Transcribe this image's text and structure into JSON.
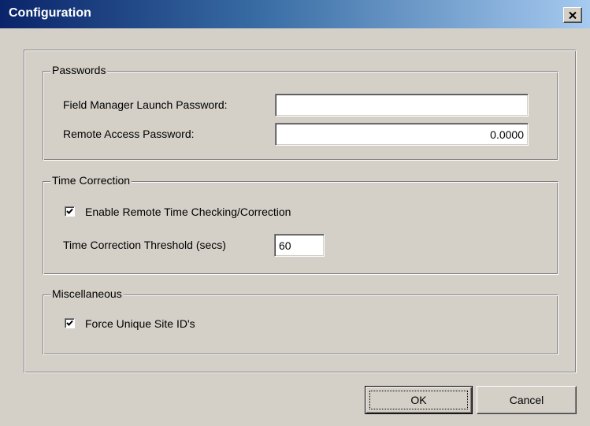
{
  "window": {
    "title": "Configuration"
  },
  "passwords": {
    "title": "Passwords",
    "launch_label": "Field Manager Launch Password:",
    "launch_value": "",
    "remote_label": "Remote Access Password:",
    "remote_value": "0.0000"
  },
  "time_correction": {
    "title": "Time Correction",
    "enable_label": "Enable Remote Time Checking/Correction",
    "enable_checked": true,
    "threshold_label": "Time Correction Threshold (secs)",
    "threshold_value": "60"
  },
  "misc": {
    "title": "Miscellaneous",
    "force_label": "Force Unique Site ID's",
    "force_checked": true
  },
  "buttons": {
    "ok": "OK",
    "cancel": "Cancel"
  },
  "icons": {
    "close": "close-icon",
    "check": "checkmark-icon"
  }
}
